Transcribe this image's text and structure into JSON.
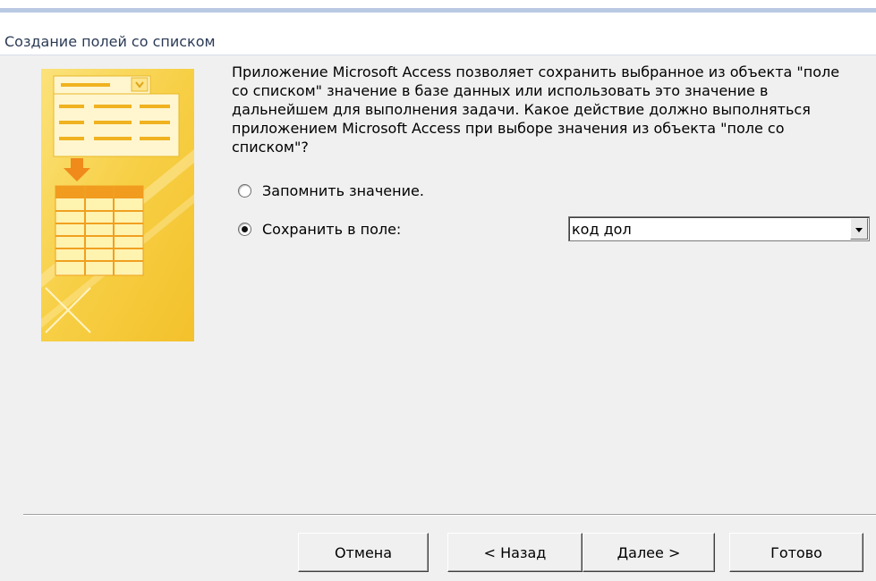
{
  "window": {
    "title": "Создание полей со списком"
  },
  "description": "Приложение Microsoft Access позволяет сохранить выбранное из объекта \"поле\nсо списком\" значение в базе данных или использовать это значение в\nдальнейшем для выполнения задачи. Какое действие должно выполняться\nприложением Microsoft Access при выборе значения из объекта \"поле со\nсписком\"?",
  "options": [
    {
      "label": "Запомнить значение.",
      "checked": false
    },
    {
      "label": "Сохранить в поле:",
      "checked": true
    }
  ],
  "field_select": {
    "value": "код дол"
  },
  "buttons": {
    "cancel": "Отмена",
    "back": "< Назад",
    "next": "Далее >",
    "finish": "Готово"
  },
  "colors": {
    "illustration_yellow": "#f7c936",
    "dialog_background": "#f0f0f0"
  }
}
